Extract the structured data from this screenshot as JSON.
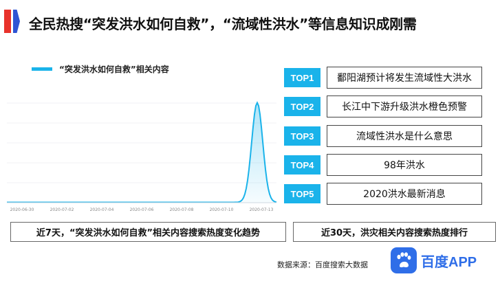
{
  "title": "全民热搜“突发洪水如何自救”，“流域性洪水”等信息知识成刚需",
  "chart_data": {
    "type": "area",
    "legend": "“突发洪水如何自救”相关内容",
    "x_tick_labels": [
      "2020-06-30",
      "2020-07-02",
      "2020-07-04",
      "2020-07-06",
      "2020-07-08",
      "2020-07-10",
      "2020-07-13"
    ],
    "x_range": [
      "2020-06-30",
      "2020-07-14"
    ],
    "peak_date": "2020-07-13",
    "peak_relative_value": 1.0,
    "series_color": "#1ab3ea",
    "grid": true,
    "legend_position": "top-left"
  },
  "top_list": [
    {
      "rank": "TOP1",
      "text": "鄱阳湖预计将发生流域性大洪水"
    },
    {
      "rank": "TOP2",
      "text": "长江中下游升级洪水橙色预警"
    },
    {
      "rank": "TOP3",
      "text": "流域性洪水是什么意思"
    },
    {
      "rank": "TOP4",
      "text": "98年洪水"
    },
    {
      "rank": "TOP5",
      "text": "2020洪水最新消息"
    }
  ],
  "captions": {
    "left": "近7天，“突发洪水如何自救”相关内容搜索热度变化趋势",
    "right": "近30天，洪灾相关内容搜索热度排行"
  },
  "source": "数据来源：百度搜索大数据",
  "brand": {
    "name": "百度APP",
    "icon": "baidu-paw-icon"
  },
  "colors": {
    "accent_red": "#e8322b",
    "accent_blue": "#2f55d4",
    "badge": "#1ab3ea",
    "brand": "#2f6ee8"
  }
}
